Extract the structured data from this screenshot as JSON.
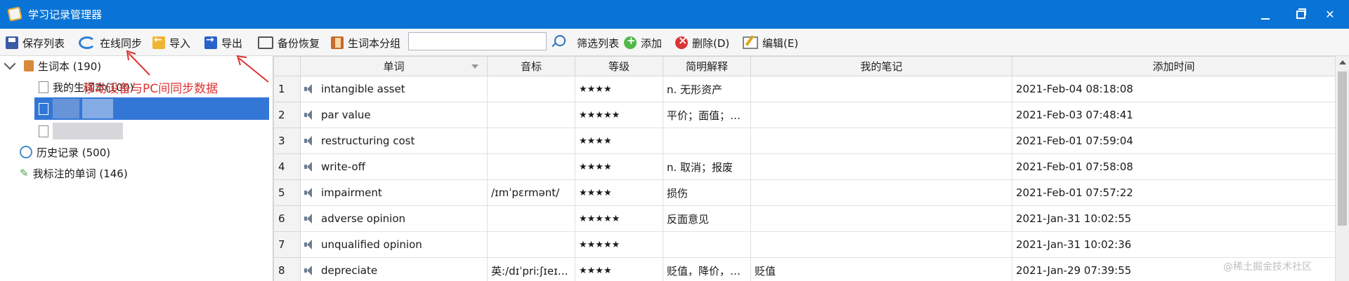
{
  "window": {
    "title": "学习记录管理器"
  },
  "toolbar": {
    "save_list": "保存列表",
    "online_sync": "在线同步",
    "import": "导入",
    "export": "导出",
    "backup_restore": "备份恢复",
    "wordbook_group": "生词本分组",
    "search_value": "",
    "filter_list": "筛选列表",
    "add": "添加",
    "delete": "删除(D)",
    "edit": "编辑(E)"
  },
  "tree": {
    "wordbook": "生词本 (190)",
    "child_1": "我的生词本(100)",
    "history": "历史记录 (500)",
    "marked": "我标注的单词 (146)"
  },
  "annotation": "移动设备与PC间同步数据",
  "grid": {
    "columns": [
      "",
      "单词",
      "音标",
      "等级",
      "简明解释",
      "我的笔记",
      "添加时间"
    ],
    "rows": [
      {
        "n": "1",
        "word": "intangible asset",
        "phonetic": "",
        "level": "★★★★",
        "brief": "n. 无形资产",
        "note": "",
        "time": "2021-Feb-04 08:18:08"
      },
      {
        "n": "2",
        "word": "par value",
        "phonetic": "",
        "level": "★★★★★",
        "brief": "平价；面值；票...",
        "note": "",
        "time": "2021-Feb-03 07:48:41"
      },
      {
        "n": "3",
        "word": "restructuring cost",
        "phonetic": "",
        "level": "★★★★",
        "brief": "",
        "note": "",
        "time": "2021-Feb-01 07:59:04"
      },
      {
        "n": "4",
        "word": "write-off",
        "phonetic": "",
        "level": "★★★★",
        "brief": "n. 取消；报废",
        "note": "",
        "time": "2021-Feb-01 07:58:08"
      },
      {
        "n": "5",
        "word": "impairment",
        "phonetic": "/ɪmˈpɛrmənt/",
        "level": "★★★★",
        "brief": "损伤",
        "note": "",
        "time": "2021-Feb-01 07:57:22"
      },
      {
        "n": "6",
        "word": "adverse opinion",
        "phonetic": "",
        "level": "★★★★★",
        "brief": "反面意见",
        "note": "",
        "time": "2021-Jan-31 10:02:55"
      },
      {
        "n": "7",
        "word": "unqualified opinion",
        "phonetic": "",
        "level": "★★★★★",
        "brief": "",
        "note": "",
        "time": "2021-Jan-31 10:02:36"
      },
      {
        "n": "8",
        "word": "depreciate",
        "phonetic": "英:/dɪˈpriːʃɪeɪt/...",
        "level": "★★★★",
        "brief": "贬值，降价，轻...",
        "note": "贬值",
        "time": "2021-Jan-29 07:39:55"
      }
    ]
  },
  "watermark": "@稀土掘金技术社区",
  "colors": {
    "titlebar": "#0a74d6",
    "selection": "#3377d6",
    "annotation": "#dd3333"
  }
}
